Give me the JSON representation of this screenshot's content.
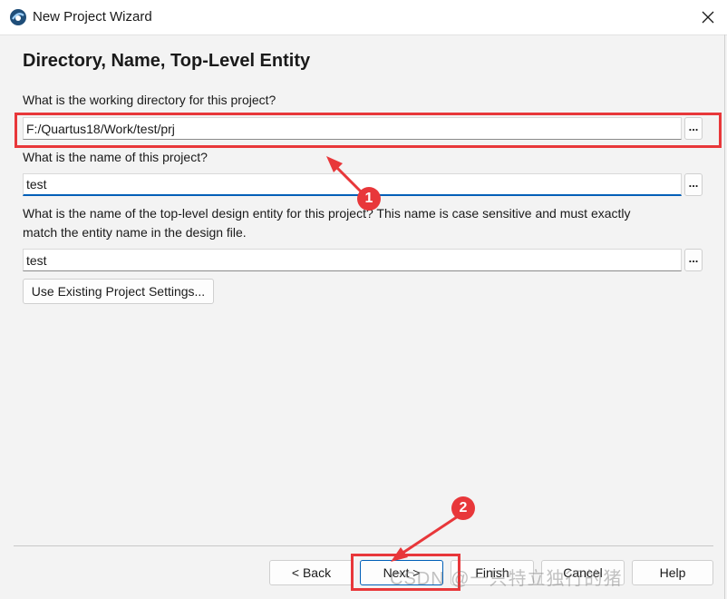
{
  "window": {
    "title": "New Project Wizard"
  },
  "page": {
    "heading": "Directory, Name, Top-Level Entity"
  },
  "directory": {
    "label": "What is the working directory for this project?",
    "value": "F:/Quartus18/Work/test/prj",
    "browse_label": "..."
  },
  "project_name": {
    "label": "What is the name of this project?",
    "value": "test",
    "browse_label": "..."
  },
  "top_entity": {
    "label_line1": "What is the name of the top-level design entity for this project? This name is case sensitive and must exactly",
    "label_line2": "match the entity name in the design file.",
    "value": "test",
    "browse_label": "..."
  },
  "use_existing_label": "Use Existing Project Settings...",
  "footer": {
    "back_label": "< Back",
    "next_label": "Next >",
    "finish_label": "Finish",
    "cancel_label": "Cancel",
    "help_label": "Help"
  },
  "annotations": {
    "marker_1": "1",
    "marker_2": "2",
    "color": "#e8373a"
  },
  "watermark": "CSDN @一只特立独行的猪"
}
